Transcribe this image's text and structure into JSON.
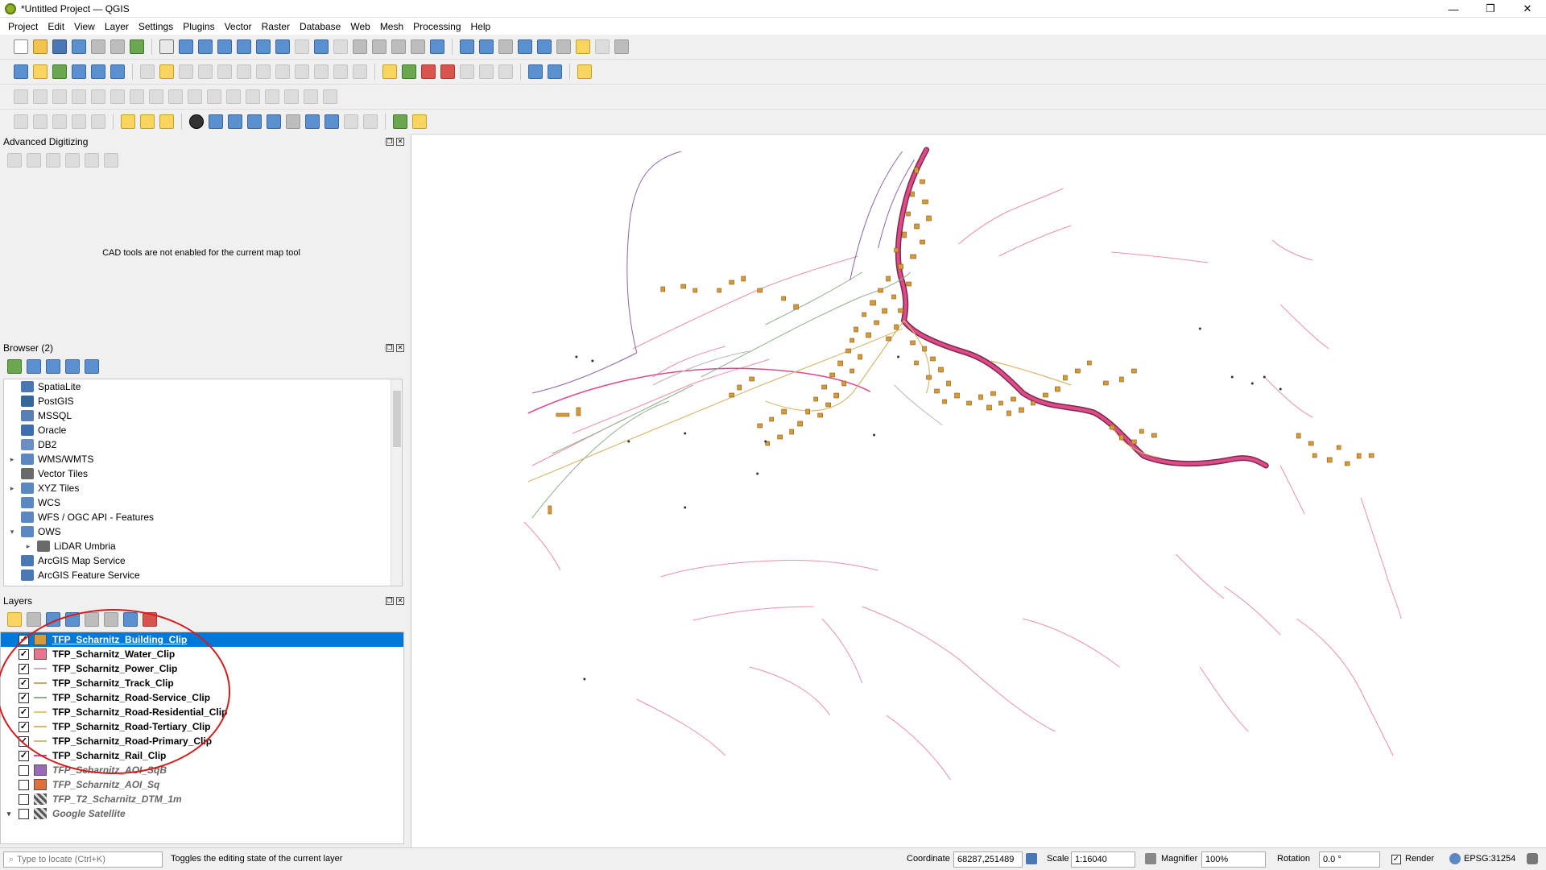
{
  "window": {
    "title": "*Untitled Project — QGIS",
    "minimize": "—",
    "maximize": "❐",
    "close": "✕"
  },
  "menu": [
    "Project",
    "Edit",
    "View",
    "Layer",
    "Settings",
    "Plugins",
    "Vector",
    "Raster",
    "Database",
    "Web",
    "Mesh",
    "Processing",
    "Help"
  ],
  "panels": {
    "advanced_digitizing": {
      "title": "Advanced Digitizing",
      "message": "CAD tools are not enabled for the current map tool"
    },
    "browser": {
      "title": "Browser (2)",
      "items": [
        {
          "label": "SpatiaLite",
          "icon": "spatialite-icon",
          "color": "#4a78b5",
          "arrow": "",
          "indent": 0
        },
        {
          "label": "PostGIS",
          "icon": "postgis-icon",
          "color": "#336699",
          "arrow": "",
          "indent": 0
        },
        {
          "label": "MSSQL",
          "icon": "mssql-icon",
          "color": "#5a7fb8",
          "arrow": "",
          "indent": 0
        },
        {
          "label": "Oracle",
          "icon": "oracle-icon",
          "color": "#3d6fb0",
          "arrow": "",
          "indent": 0
        },
        {
          "label": "DB2",
          "icon": "db2-icon",
          "color": "#6b8fc2",
          "arrow": "",
          "indent": 0
        },
        {
          "label": "WMS/WMTS",
          "icon": "wms-icon",
          "color": "#5b88c0",
          "arrow": "▸",
          "indent": 0
        },
        {
          "label": "Vector Tiles",
          "icon": "vector-tiles-icon",
          "color": "#6a6a6a",
          "arrow": "",
          "indent": 0
        },
        {
          "label": "XYZ Tiles",
          "icon": "xyz-tiles-icon",
          "color": "#5b88c0",
          "arrow": "▸",
          "indent": 0
        },
        {
          "label": "WCS",
          "icon": "wcs-icon",
          "color": "#5b88c0",
          "arrow": "",
          "indent": 0
        },
        {
          "label": "WFS / OGC API - Features",
          "icon": "wfs-icon",
          "color": "#5b88c0",
          "arrow": "",
          "indent": 0
        },
        {
          "label": "OWS",
          "icon": "ows-icon",
          "color": "#5b88c0",
          "arrow": "▾",
          "indent": 0
        },
        {
          "label": "LiDAR Umbria",
          "icon": "lidar-icon",
          "color": "#6a6a6a",
          "arrow": "▸",
          "indent": 1
        },
        {
          "label": "ArcGIS Map Service",
          "icon": "arcgis-map-icon",
          "color": "#4a78b5",
          "arrow": "",
          "indent": 0
        },
        {
          "label": "ArcGIS Feature Service",
          "icon": "arcgis-feature-icon",
          "color": "#4a78b5",
          "arrow": "",
          "indent": 0
        }
      ]
    },
    "layers": {
      "title": "Layers",
      "items": [
        {
          "label": "TFP_Scharnitz_Building_Clip",
          "checked": true,
          "selected": true,
          "symbol": "fill",
          "color": "#d59a3a",
          "arrow": ""
        },
        {
          "label": "TFP_Scharnitz_Water_Clip",
          "checked": true,
          "selected": false,
          "symbol": "fill",
          "color": "#e8758f",
          "arrow": ""
        },
        {
          "label": "TFP_Scharnitz_Power_Clip",
          "checked": true,
          "selected": false,
          "symbol": "line",
          "color": "#b8b8b8",
          "arrow": ""
        },
        {
          "label": "TFP_Scharnitz_Track_Clip",
          "checked": true,
          "selected": false,
          "symbol": "line",
          "color": "#c8a86a",
          "arrow": ""
        },
        {
          "label": "TFP_Scharnitz_Road-Service_Clip",
          "checked": true,
          "selected": false,
          "symbol": "line",
          "color": "#8fb08a",
          "arrow": ""
        },
        {
          "label": "TFP_Scharnitz_Road-Residential_Clip",
          "checked": true,
          "selected": false,
          "symbol": "line",
          "color": "#e0c878",
          "arrow": ""
        },
        {
          "label": "TFP_Scharnitz_Road-Tertiary_Clip",
          "checked": true,
          "selected": false,
          "symbol": "line",
          "color": "#d8b870",
          "arrow": ""
        },
        {
          "label": "TFP_Scharnitz_Road-Primary_Clip",
          "checked": true,
          "selected": false,
          "symbol": "line",
          "color": "#c8c080",
          "arrow": ""
        },
        {
          "label": "TFP_Scharnitz_Rail_Clip",
          "checked": true,
          "selected": false,
          "symbol": "line",
          "color": "#e04a8a",
          "arrow": ""
        },
        {
          "label": "TFP_Scharnitz_AOI_SqB",
          "checked": false,
          "selected": false,
          "symbol": "fill",
          "color": "#9a6ab8",
          "arrow": ""
        },
        {
          "label": "TFP_Scharnitz_AOI_Sq",
          "checked": false,
          "selected": false,
          "symbol": "fill",
          "color": "#e0703a",
          "arrow": ""
        },
        {
          "label": "TFP_T2_Scharnitz_DTM_1m",
          "checked": false,
          "selected": false,
          "symbol": "raster",
          "color": "#555555",
          "arrow": ""
        },
        {
          "label": "Google Satellite",
          "checked": false,
          "selected": false,
          "symbol": "raster",
          "color": "#555555",
          "arrow": "▾"
        }
      ]
    }
  },
  "statusbar": {
    "locator_placeholder": "Type to locate (Ctrl+K)",
    "message": "Toggles the editing state of the current layer",
    "coordinate_label": "Coordinate",
    "coordinate_value": "68287,251489",
    "scale_label": "Scale",
    "scale_value": "1:16040",
    "magnifier_label": "Magnifier",
    "magnifier_value": "100%",
    "rotation_label": "Rotation",
    "rotation_value": "0.0 °",
    "render_label": "Render",
    "render_checked": true,
    "crs": "EPSG:31254"
  },
  "check_mark": "✓",
  "colors": {
    "selection": "#0078d7",
    "annotation_ring": "#d41c1c",
    "building": "#d59a3a",
    "water": "#e8758f",
    "rail": "#e04a8a"
  }
}
